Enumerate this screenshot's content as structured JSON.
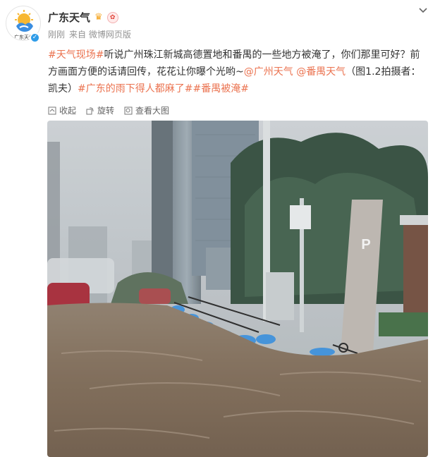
{
  "author": {
    "name": "广东天气",
    "avatar_label": "广东天气",
    "verified_icon": "verified-badge-icon",
    "crown_icon": "crown-icon"
  },
  "meta": {
    "time": "刚刚",
    "source": "来自 微博网页版"
  },
  "post": {
    "tag1": "#天气现场#",
    "text1": "听说广州珠江新城高德置地和番禺的一些地方被淹了，你们那里可好？前方画面方便的话请回传，花花让你曝个光哟~",
    "mention1": "@广州天气",
    "mention2": "@番禺天气",
    "text2": "（图1.2拍摄者：凯夫）",
    "tag2": "#广东的雨下得人都麻了#",
    "tag3": "#番禺被淹#"
  },
  "actions": {
    "collapse": "收起",
    "rotate": "旋转",
    "view_large": "查看大图"
  },
  "photo": {
    "sign_letter": "P"
  },
  "colors": {
    "accent": "#eb7350",
    "verified": "#2f9ce8"
  }
}
